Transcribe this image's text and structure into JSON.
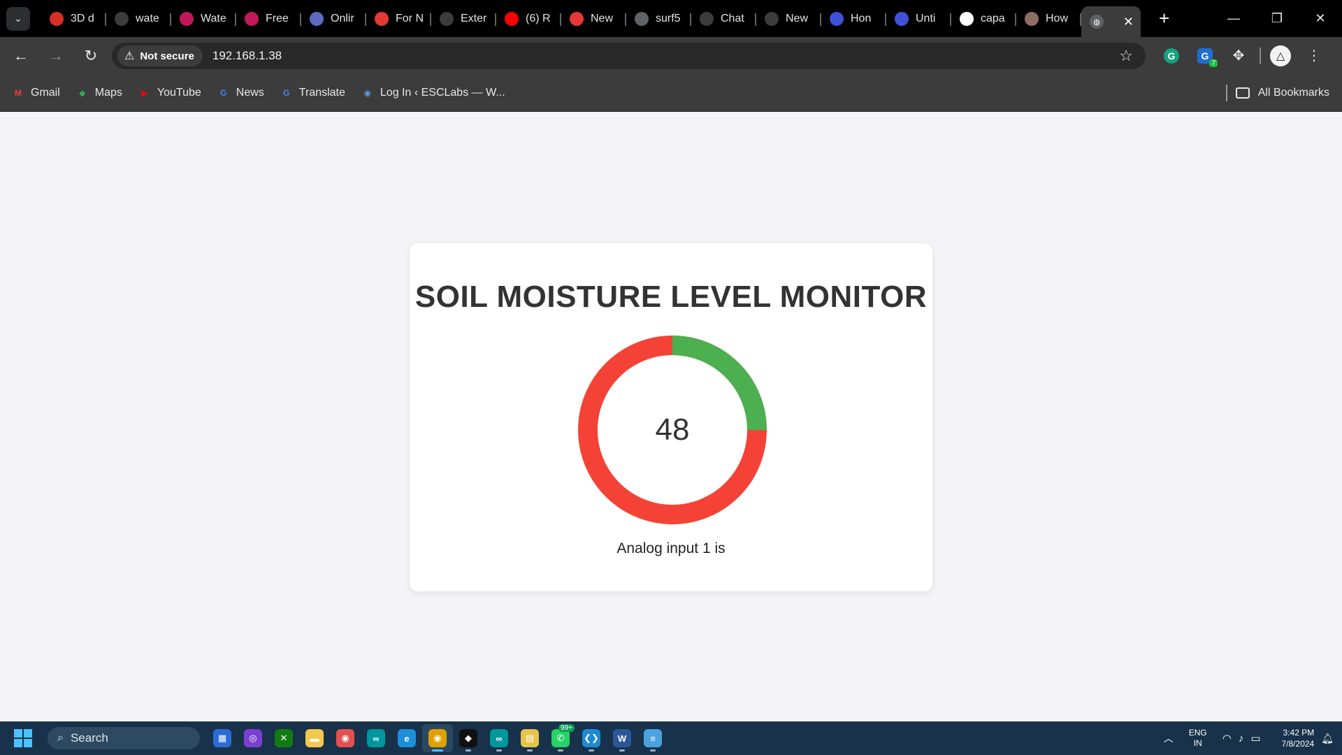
{
  "browser": {
    "tabs": [
      {
        "title": "3D d",
        "icon": "grid-icon",
        "color": "#d93025"
      },
      {
        "title": "wate",
        "icon": "openai-icon",
        "color": "#3c3c3c"
      },
      {
        "title": "Wate",
        "icon": "pink-circle-icon",
        "color": "#c2185b"
      },
      {
        "title": "Free",
        "icon": "pink-circle-icon",
        "color": "#c2185b"
      },
      {
        "title": "Onlir",
        "icon": "blue-circle-icon",
        "color": "#5c6bc0"
      },
      {
        "title": "For N",
        "icon": "red-arc-icon",
        "color": "#e53935"
      },
      {
        "title": "Exter",
        "icon": "puzzle-icon",
        "color": "#3c3c3c"
      },
      {
        "title": "(6) R",
        "icon": "youtube-icon",
        "color": "#ff0000"
      },
      {
        "title": "New",
        "icon": "red-arc-icon",
        "color": "#e53935"
      },
      {
        "title": "surf5",
        "icon": "globe-icon",
        "color": "#5f6368"
      },
      {
        "title": "Chat",
        "icon": "openai-icon",
        "color": "#3c3c3c"
      },
      {
        "title": "New",
        "icon": "chrome-icon",
        "color": "#3c3c3c"
      },
      {
        "title": "Hon",
        "icon": "canva-icon",
        "color": "#3f51d9"
      },
      {
        "title": "Unti",
        "icon": "canva-icon",
        "color": "#3f51d9"
      },
      {
        "title": "capa",
        "icon": "google-icon",
        "color": "#ffffff"
      },
      {
        "title": "How",
        "icon": "image-icon",
        "color": "#8d6e63"
      }
    ],
    "active_tab": {
      "icon": "globe-icon",
      "close": "✕"
    },
    "new_tab": "+",
    "window_controls": {
      "minimize": "—",
      "restore": "❐",
      "close": "✕"
    },
    "security_label": "Not secure",
    "url": "192.168.1.38",
    "extensions": [
      {
        "name": "grammarly-icon",
        "label": "G"
      },
      {
        "name": "grammarly-docs-icon",
        "label": "G",
        "badge": "7"
      }
    ],
    "bookmarks": [
      {
        "label": "Gmail",
        "icon": "gmail-icon",
        "color": "#ea4335",
        "glyph": "M"
      },
      {
        "label": "Maps",
        "icon": "maps-icon",
        "color": "#34a853",
        "glyph": "◆"
      },
      {
        "label": "YouTube",
        "icon": "youtube-icon",
        "color": "#ff0000",
        "glyph": "▶"
      },
      {
        "label": "News",
        "icon": "news-icon",
        "color": "#4285f4",
        "glyph": "G"
      },
      {
        "label": "Translate",
        "icon": "translate-icon",
        "color": "#4285f4",
        "glyph": "G"
      },
      {
        "label": "Log In ‹ ESCLabs — W...",
        "icon": "login-icon",
        "color": "#5a9be6",
        "glyph": "◉"
      }
    ],
    "all_bookmarks": "All Bookmarks"
  },
  "page": {
    "title": "SOIL MOISTURE LEVEL MONITOR",
    "gauge_value": "48",
    "gauge_fraction": 0.25,
    "gauge_colors": {
      "fill": "#4caf50",
      "remainder": "#f44336"
    },
    "caption": "Analog input 1 is"
  },
  "taskbar": {
    "search_label": "Search",
    "apps": [
      {
        "name": "store-icon",
        "color": "#2b6cd4",
        "glyph": "▦"
      },
      {
        "name": "app-purple-icon",
        "color": "#7b3fd1",
        "glyph": "◎"
      },
      {
        "name": "xbox-icon",
        "color": "#107c10",
        "glyph": "✕"
      },
      {
        "name": "file-explorer-icon",
        "color": "#f2c94c",
        "glyph": "▬"
      },
      {
        "name": "app-red-icon",
        "color": "#e35050",
        "glyph": "◉"
      },
      {
        "name": "arduino-icon",
        "color": "#00979d",
        "glyph": "∞"
      },
      {
        "name": "edge-icon",
        "color": "#1b8fd8",
        "glyph": "e"
      },
      {
        "name": "chrome-icon",
        "color": "#e0a100",
        "glyph": "◉",
        "active": true
      },
      {
        "name": "capcut-icon",
        "color": "#111111",
        "glyph": "◆"
      },
      {
        "name": "arduino-ide-icon",
        "color": "#00979d",
        "glyph": "∞"
      },
      {
        "name": "notes-icon",
        "color": "#e6c34a",
        "glyph": "▤"
      },
      {
        "name": "whatsapp-icon",
        "color": "#25d366",
        "glyph": "✆",
        "badge": "99+"
      },
      {
        "name": "vscode-icon",
        "color": "#1f8ad2",
        "glyph": "❮❯"
      },
      {
        "name": "word-icon",
        "color": "#2b579a",
        "glyph": "W"
      },
      {
        "name": "notepad-icon",
        "color": "#4aa3df",
        "glyph": "≡"
      }
    ],
    "lang_line1": "ENG",
    "lang_line2": "IN",
    "time": "3:42 PM",
    "date": "7/8/2024"
  }
}
